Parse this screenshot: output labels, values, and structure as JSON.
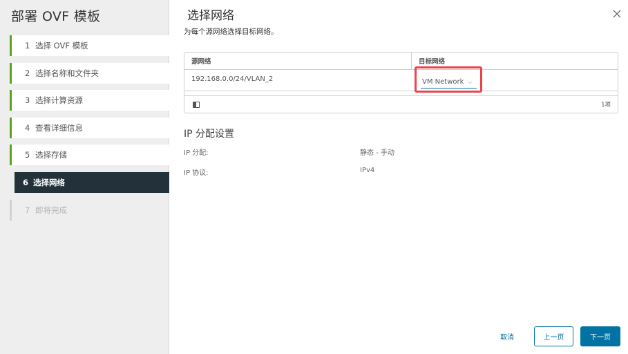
{
  "wizard": {
    "title": "部署 OVF 模板",
    "steps": [
      {
        "num": "1",
        "label": "选择 OVF 模板"
      },
      {
        "num": "2",
        "label": "选择名称和文件夹"
      },
      {
        "num": "3",
        "label": "选择计算资源"
      },
      {
        "num": "4",
        "label": "查看详细信息"
      },
      {
        "num": "5",
        "label": "选择存储"
      },
      {
        "num": "6",
        "label": "选择网络"
      },
      {
        "num": "7",
        "label": "即将完成"
      }
    ],
    "current_step": 6
  },
  "page": {
    "title": "选择网络",
    "subtitle": "为每个源网络选择目标网络。"
  },
  "network_grid": {
    "columns": {
      "source": "源网络",
      "destination": "目标网络"
    },
    "rows": [
      {
        "source": "192.168.0.0/24/VLAN_2",
        "destination": "VM Network"
      }
    ],
    "item_count": "1项"
  },
  "ip_settings": {
    "title": "IP 分配设置",
    "allocation_label": "IP 分配:",
    "allocation_value": "静态 - 手动",
    "protocol_label": "IP 协议:",
    "protocol_value": "IPv4"
  },
  "buttons": {
    "cancel": "取消",
    "back": "上一页",
    "next": "下一页"
  },
  "colors": {
    "accent": "#0072a3",
    "completed_step": "#5aa220",
    "current_step_bg": "#22313a",
    "highlight": "#e8454e"
  }
}
